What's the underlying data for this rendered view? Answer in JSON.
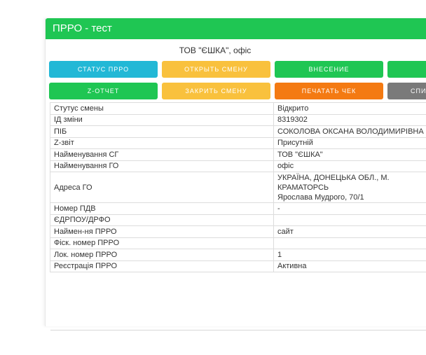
{
  "header": {
    "title": "ПРРО - тест"
  },
  "company": "ТОВ \"ЄШКА\", офіс",
  "buttons_row1": [
    {
      "label": "СТАТУС ПРРО",
      "color": "#22b8d6"
    },
    {
      "label": "ОТКРЫТЬ СМЕНУ",
      "color": "#f9c13d"
    },
    {
      "label": "ВНЕСЕНИЕ",
      "color": "#1fc653"
    },
    {
      "label": "",
      "color": "#1fc653"
    }
  ],
  "buttons_row2": [
    {
      "label": "Z-ОТЧЕТ",
      "color": "#1fc653"
    },
    {
      "label": "ЗАКРИТЬ СМЕНУ",
      "color": "#f9c13d"
    },
    {
      "label": "ПЕЧАТАТЬ ЧЕК",
      "color": "#f47a12"
    },
    {
      "label": "СПИС",
      "color": "#7a7a7a"
    }
  ],
  "info_rows": [
    {
      "key": "Стутус смены",
      "value": "Відкрито"
    },
    {
      "key": "ІД зміни",
      "value": "8319302"
    },
    {
      "key": "ПІБ",
      "value": "СОКОЛОВА ОКСАНА ВОЛОДИМИРІВНА"
    },
    {
      "key": "Z-звіт",
      "value": "Присутній"
    },
    {
      "key": "Найменування СГ",
      "value": "ТОВ \"ЄШКА\""
    },
    {
      "key": "Найменування ГО",
      "value": "офіс"
    },
    {
      "key": "Адреса ГО",
      "value": "УКРАЇНА, ДОНЕЦЬКА ОБЛ., М. КРАМАТОРСЬ",
      "value2": "Ярослава Мудрого, 70/1"
    },
    {
      "key": "Номер ПДВ",
      "value": "-"
    },
    {
      "key": "ЄДРПОУ/ДРФО",
      "value": ""
    },
    {
      "key": "Наймен-ня ПРРО",
      "value": "сайт"
    },
    {
      "key": "Фіск. номер ПРРО",
      "value": ""
    },
    {
      "key": "Лок. номер ПРРО",
      "value": "1"
    },
    {
      "key": "Реєстрація ПРРО",
      "value": "Активна"
    }
  ]
}
